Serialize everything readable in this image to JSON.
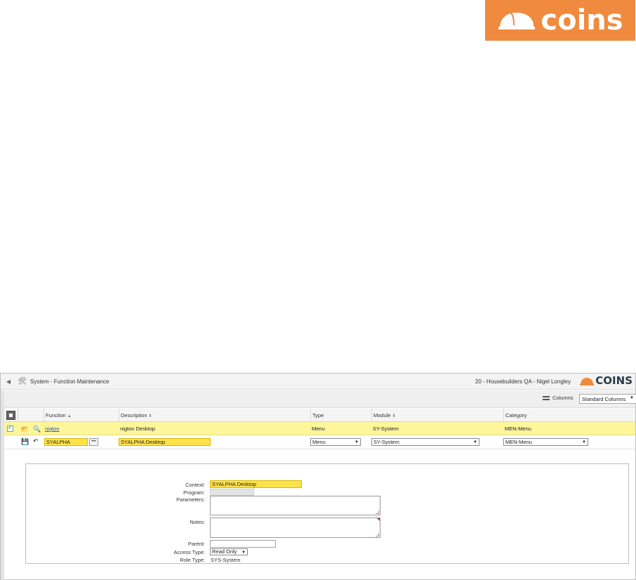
{
  "brand": {
    "logo_text": "coins",
    "color": "#f08a3e"
  },
  "window": {
    "title": "System - Function Maintenance",
    "user_context": "20 - Housebuilders QA - Nigel Longley",
    "logo_text": "COINS"
  },
  "toolbar": {
    "columns_label": "Columns",
    "column_set": "Standard Columns"
  },
  "grid": {
    "headers": {
      "function": "Function",
      "description": "Description",
      "type": "Type",
      "module": "Module",
      "category": "Category"
    },
    "row": {
      "function": "nigton",
      "description": "nigton Desktop",
      "type": "Menu",
      "module": "SY-System",
      "category": "MEN-Menu"
    },
    "edit_row": {
      "function": "SYALPHA",
      "ellipsis": "•••",
      "description": "SYALPHA Desktop",
      "type": "Menu",
      "module": "SY-System",
      "category": "MEN-Menu"
    }
  },
  "detail": {
    "context_label": "Context:",
    "context_value": "SYALPHA Desktop",
    "program_label": "Program:",
    "parameters_label": "Parameters:",
    "notes_label": "Notes:",
    "parent_label": "Parent:",
    "access_type_label": "Access Type:",
    "access_type_value": "Read Only",
    "role_type_label": "Role Type:",
    "role_type_value": "SYS-System"
  }
}
